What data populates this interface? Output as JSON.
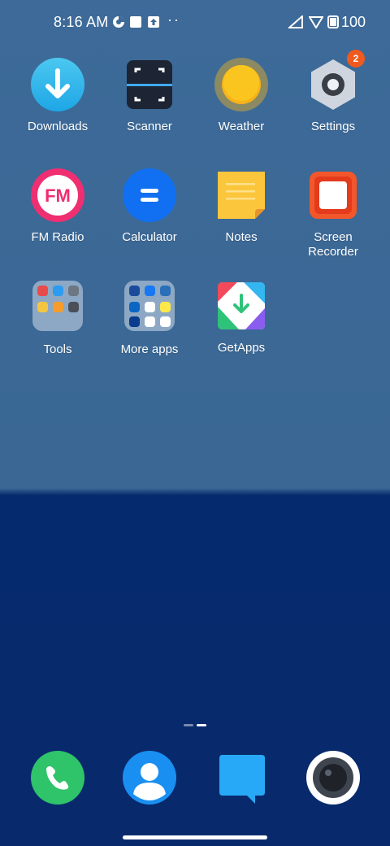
{
  "status_bar": {
    "time": "8:16 AM",
    "overflow": "··",
    "battery": "100",
    "icons": [
      "data-saver-icon",
      "notification-square-icon",
      "upload-icon",
      "signal-icon",
      "wifi-icon",
      "battery-icon"
    ]
  },
  "apps": [
    {
      "label": "Downloads",
      "icon": "downloads-icon"
    },
    {
      "label": "Scanner",
      "icon": "scanner-icon"
    },
    {
      "label": "Weather",
      "icon": "weather-icon"
    },
    {
      "label": "Settings",
      "icon": "settings-icon",
      "badge": "2"
    },
    {
      "label": "FM Radio",
      "icon": "fm-radio-icon",
      "text": "FM"
    },
    {
      "label": "Calculator",
      "icon": "calculator-icon"
    },
    {
      "label": "Notes",
      "icon": "notes-icon"
    },
    {
      "label": "Screen\nRecorder",
      "icon": "screen-recorder-icon"
    },
    {
      "label": "Tools",
      "icon": "tools-folder-icon"
    },
    {
      "label": "More apps",
      "icon": "more-apps-folder-icon"
    },
    {
      "label": "GetApps",
      "icon": "getapps-icon"
    }
  ],
  "dock": [
    {
      "icon": "phone-icon"
    },
    {
      "icon": "contacts-icon"
    },
    {
      "icon": "messages-icon"
    },
    {
      "icon": "camera-icon"
    }
  ],
  "colors": {
    "wallpaper_top": "#3d6a98",
    "wallpaper_bottom": "#082a6c",
    "badge": "#f05a1e"
  }
}
